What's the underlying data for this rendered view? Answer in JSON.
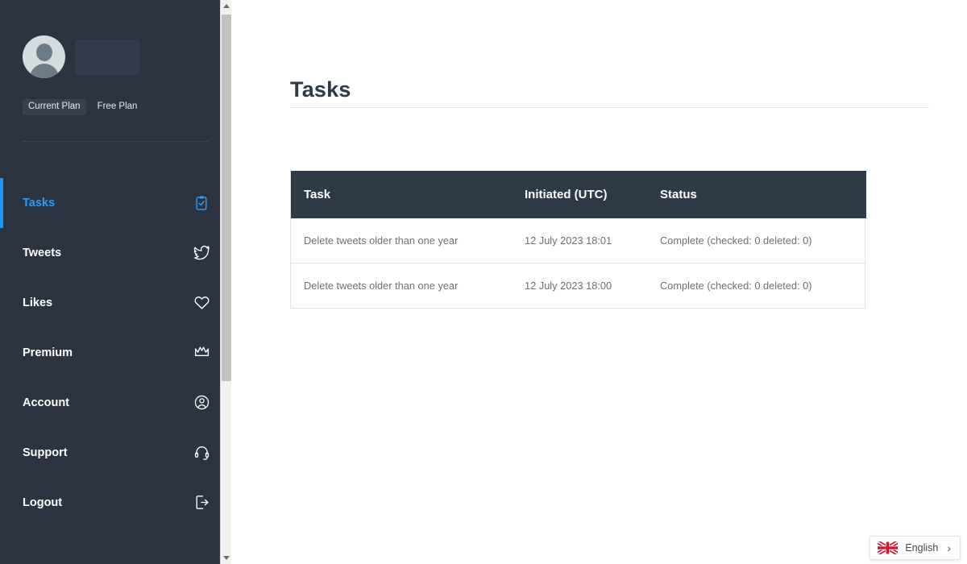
{
  "sidebar": {
    "profile": {
      "avatar_icon": "user-avatar-icon",
      "username": ""
    },
    "plan": {
      "badge_label": "Current Plan",
      "value": "Free Plan"
    },
    "items": [
      {
        "label": "Tasks",
        "icon": "clipboard-check-icon",
        "active": true
      },
      {
        "label": "Tweets",
        "icon": "twitter-bird-icon",
        "active": false
      },
      {
        "label": "Likes",
        "icon": "heart-icon",
        "active": false
      },
      {
        "label": "Premium",
        "icon": "crown-icon",
        "active": false
      },
      {
        "label": "Account",
        "icon": "user-circle-icon",
        "active": false
      },
      {
        "label": "Support",
        "icon": "headset-icon",
        "active": false
      },
      {
        "label": "Logout",
        "icon": "logout-door-icon",
        "active": false
      }
    ],
    "scrollbar": {
      "up_icon": "scroll-up-arrow-icon",
      "down_icon": "scroll-down-arrow-icon"
    }
  },
  "main": {
    "page_title": "Tasks",
    "table": {
      "columns": [
        "Task",
        "Initiated (UTC)",
        "Status"
      ],
      "rows": [
        {
          "task": "Delete tweets older than one year",
          "initiated": "12 July 2023 18:01",
          "status": "Complete (checked: 0 deleted: 0)"
        },
        {
          "task": "Delete tweets older than one year",
          "initiated": "12 July 2023 18:00",
          "status": "Complete (checked: 0 deleted: 0)"
        }
      ]
    }
  },
  "language_widget": {
    "flag_icon": "union-jack-flag-icon",
    "label": "English",
    "chevron_icon": "chevron-right-icon",
    "chevron_glyph": "›"
  },
  "colors": {
    "sidebar_bg": "#2c3442",
    "accent_blue": "#2196f3",
    "table_header_bg": "#2f3a47",
    "main_bg": "#ffffff",
    "body_text": "#6b7178"
  }
}
